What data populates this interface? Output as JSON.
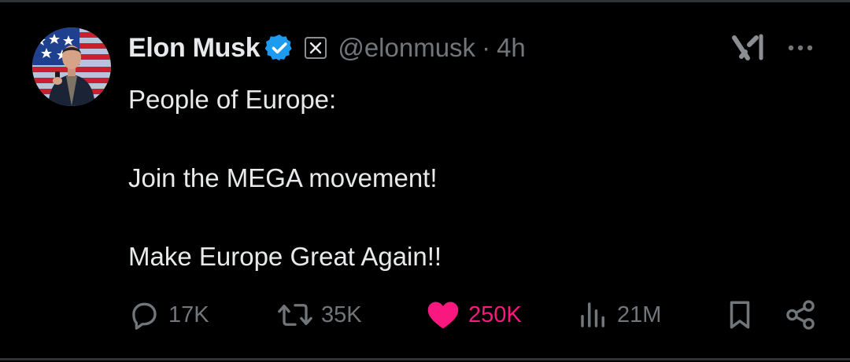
{
  "tweet": {
    "author": {
      "name": "Elon Musk",
      "handle": "@elonmusk",
      "verified": true,
      "avatar": "avatar-photo"
    },
    "separator": "·",
    "time": "4h",
    "text": {
      "line1": "People of Europe:",
      "line2": "Join the MEGA movement!",
      "line3": "Make Europe Great Again!!"
    },
    "actions": {
      "replies": "17K",
      "reposts": "35K",
      "likes": "250K",
      "views": "21M"
    },
    "liked": true
  },
  "icons": {
    "verified": "verified-badge-icon",
    "affiliate": "x-affiliate-badge-icon",
    "grok": "grok-icon",
    "more": "more-options-icon",
    "reply": "reply-icon",
    "repost": "repost-icon",
    "like": "heart-icon",
    "views": "views-icon",
    "bookmark": "bookmark-icon",
    "share": "share-icon"
  },
  "colors": {
    "background": "#000000",
    "text": "#e7e9ea",
    "secondary": "#71767b",
    "verified_blue": "#1d9bf0",
    "like_pink": "#f91880",
    "divider": "#2f3336"
  }
}
